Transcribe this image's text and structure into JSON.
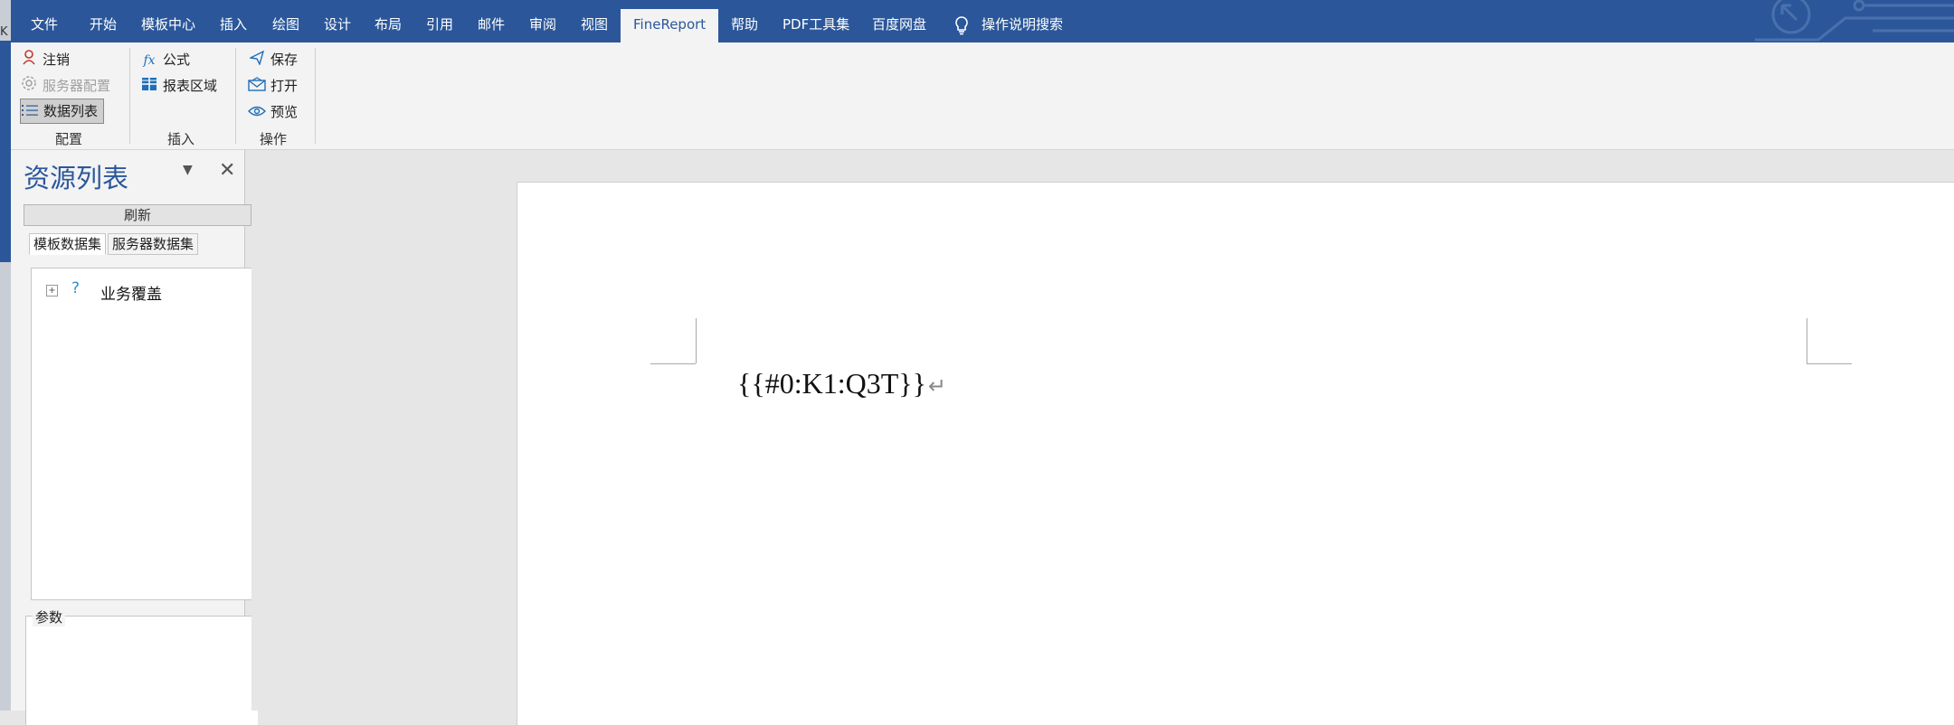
{
  "edge": {
    "char": "K"
  },
  "tabs": [
    "文件",
    "开始",
    "模板中心",
    "插入",
    "绘图",
    "设计",
    "布局",
    "引用",
    "邮件",
    "审阅",
    "视图",
    "FineReport",
    "帮助",
    "PDF工具集",
    "百度网盘"
  ],
  "tell_me": "操作说明搜索",
  "ribbon": {
    "config": {
      "logout": "注销",
      "server_config": "服务器配置",
      "data_list": "数据列表",
      "label": "配置"
    },
    "insert": {
      "formula": "公式",
      "report_area": "报表区域",
      "label": "插入"
    },
    "ops": {
      "save": "保存",
      "open": "打开",
      "preview": "预览",
      "label": "操作"
    }
  },
  "panel": {
    "title": "资源列表",
    "refresh": "刷新",
    "tabs": [
      "模板数据集",
      "服务器数据集"
    ],
    "tree": [
      {
        "label": "业务覆盖"
      }
    ],
    "params_label": "参数"
  },
  "document": {
    "text": "{{#0:K1:Q3T}}",
    "return_mark": "↵"
  },
  "colors": {
    "brand": "#2b579a",
    "ribbon_bg": "#f3f3f3",
    "doc_bg": "#e6e6e6"
  }
}
